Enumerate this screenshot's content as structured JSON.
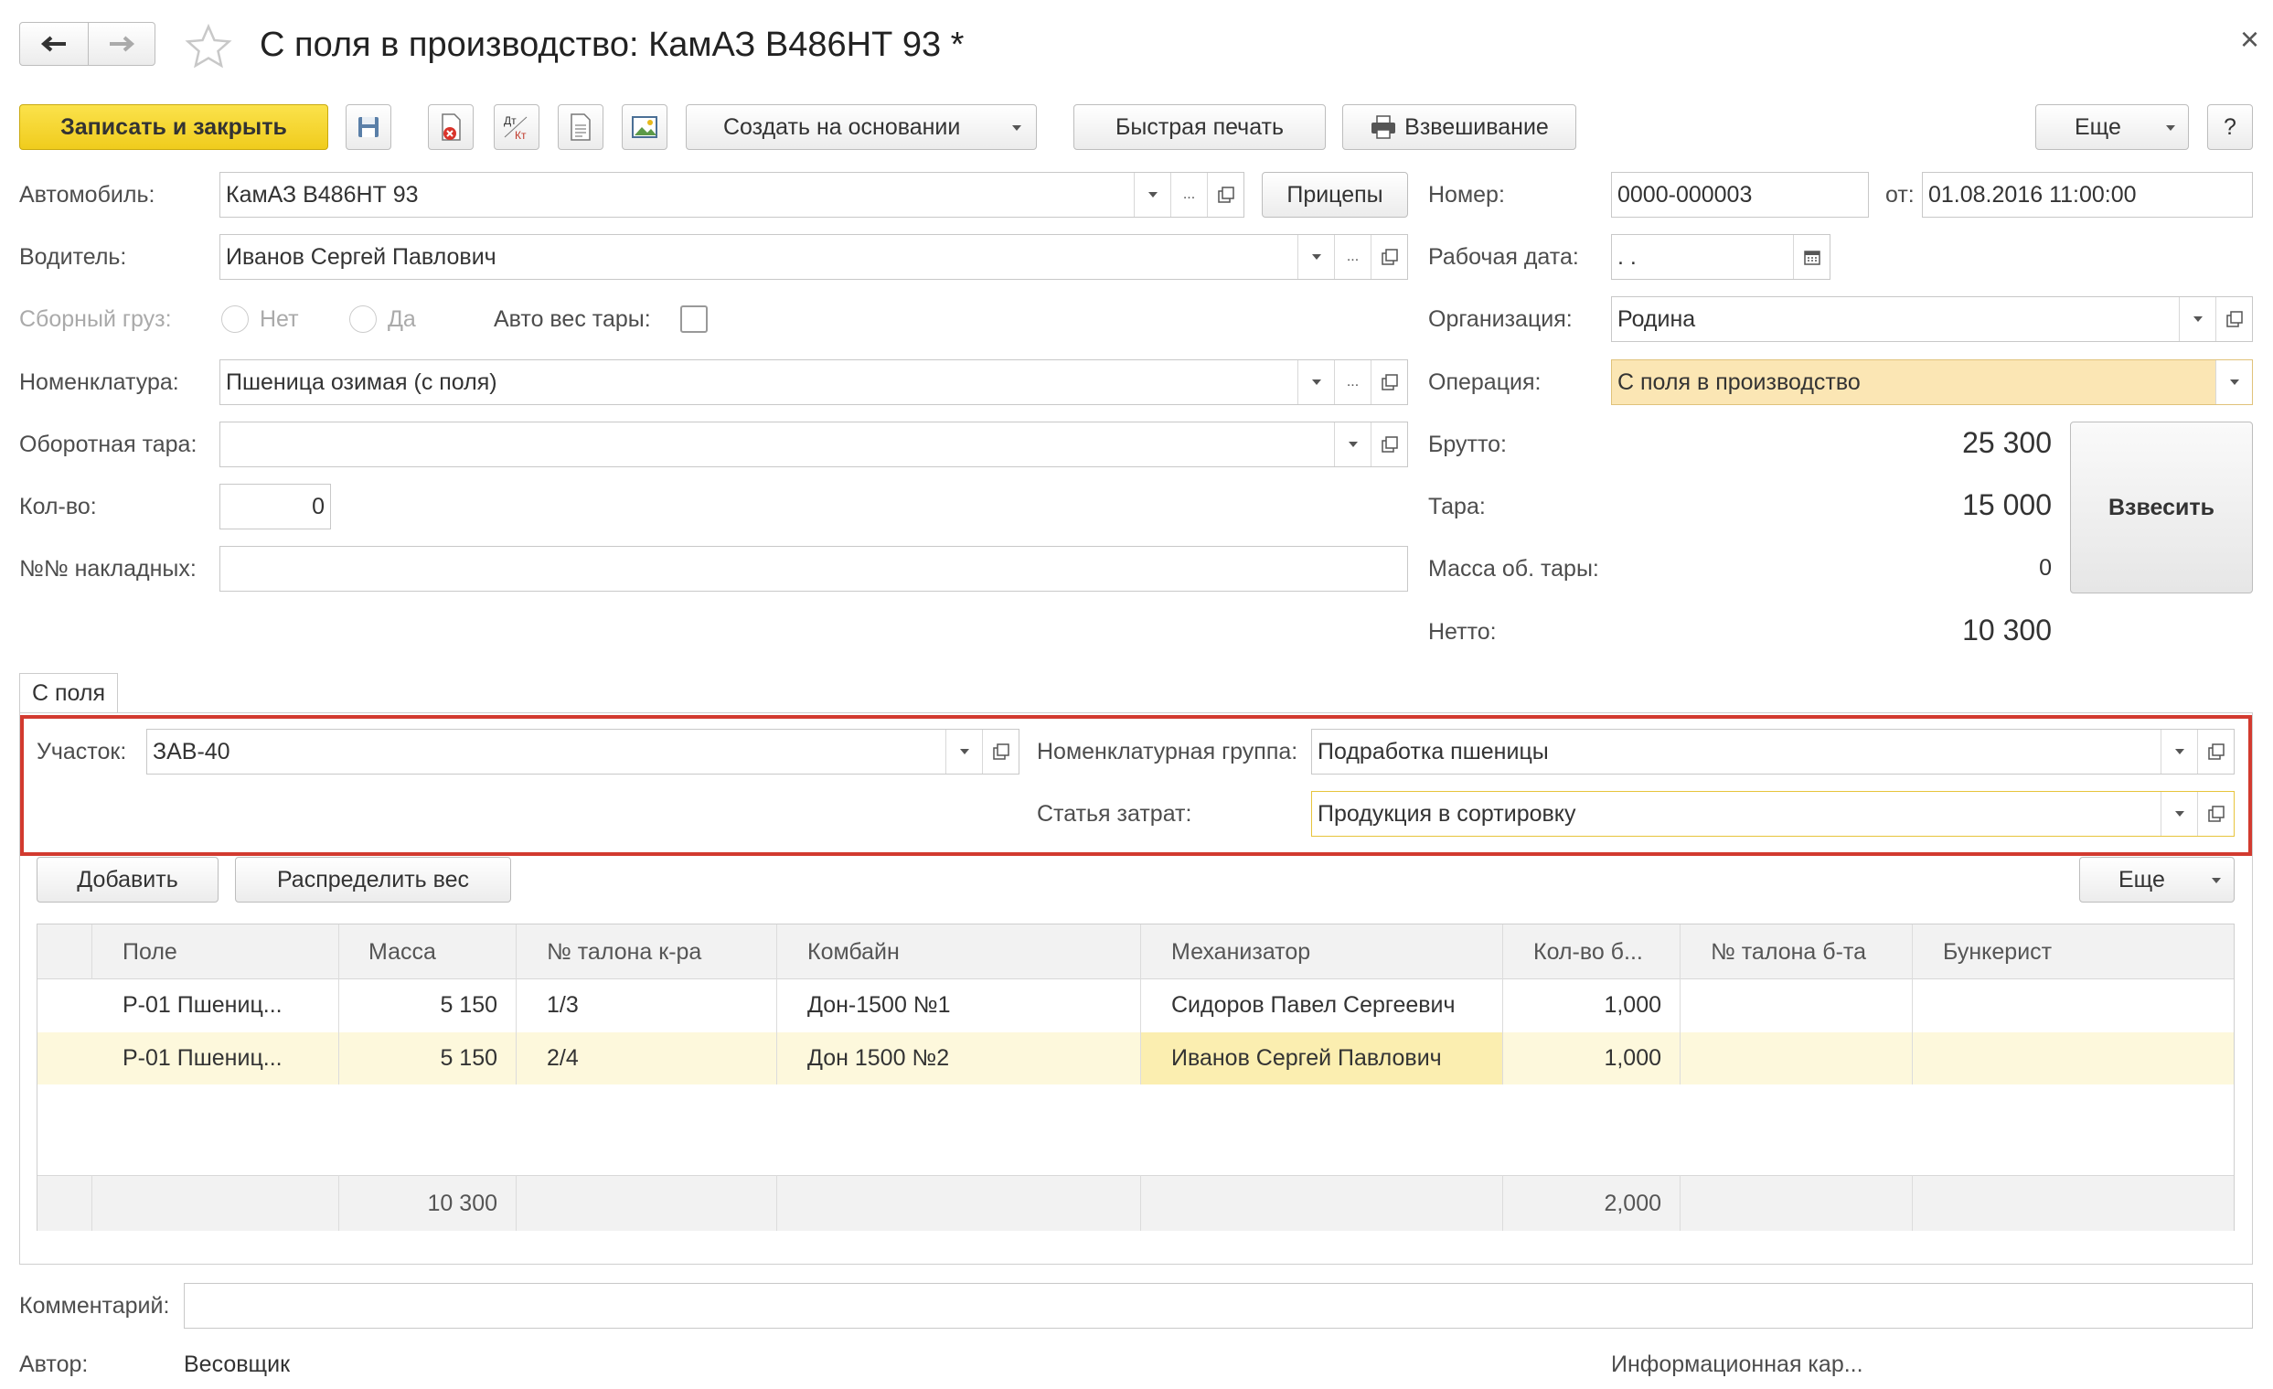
{
  "window": {
    "title": "С поля в производство: КамАЗ В486НТ 93 *",
    "close": "×"
  },
  "toolbar": {
    "save_close": "Записать и закрыть",
    "dtkt": "Дт\nКт",
    "create_based": "Создать на основании",
    "quick_print": "Быстрая печать",
    "weighing": "Взвешивание",
    "more": "Еще",
    "help": "?"
  },
  "left": {
    "car_label": "Автомобиль:",
    "car_value": "КамАЗ В486НТ 93",
    "trailers": "Прицепы",
    "driver_label": "Водитель:",
    "driver_value": "Иванов Сергей Павлович",
    "combined_label": "Сборный груз:",
    "radio_no": "Нет",
    "radio_yes": "Да",
    "auto_tare_label": "Авто вес тары:",
    "nomenclature_label": "Номенклатура:",
    "nomenclature_value": "Пшеница озимая (с поля)",
    "tare_label": "Оборотная тара:",
    "tare_value": "",
    "qty_label": "Кол-во:",
    "qty_value": "0",
    "invoices_label": "№№ накладных:",
    "invoices_value": ""
  },
  "right": {
    "number_label": "Номер:",
    "number_value": "0000-000003",
    "from_label": "от:",
    "from_value": "01.08.2016 11:00:00",
    "workdate_label": "Рабочая дата:",
    "workdate_value": " .  .",
    "org_label": "Организация:",
    "org_value": "Родина",
    "operation_label": "Операция:",
    "operation_value": "С поля в производство",
    "gross_label": "Брутто:",
    "gross_value": "25 300",
    "tare_label": "Тара:",
    "tare_value": "15 000",
    "tare_mass_label": "Масса об. тары:",
    "tare_mass_value": "0",
    "net_label": "Нетто:",
    "net_value": "10 300",
    "weigh_button": "Взвесить"
  },
  "tab": {
    "label": "С поля"
  },
  "group": {
    "section_label": "Участок:",
    "section_value": "ЗАВ-40",
    "nom_group_label": "Номенклатурная группа:",
    "nom_group_value": "Подработка пшеницы",
    "cost_label": "Статья затрат:",
    "cost_value": "Продукция в сортировку"
  },
  "table_toolbar": {
    "add": "Добавить",
    "distribute": "Распределить вес",
    "more": "Еще"
  },
  "table": {
    "headers": [
      "Поле",
      "Масса",
      "№ талона к-ра",
      "Комбайн",
      "Механизатор",
      "Кол-во б...",
      "№ талона б-та",
      "Бункерист"
    ],
    "rows": [
      [
        "Р-01 Пшениц...",
        "5 150",
        "1/3",
        "Дон-1500 №1",
        "Сидоров Павел Сергеевич",
        "1,000",
        "",
        ""
      ],
      [
        "Р-01 Пшениц...",
        "5 150",
        "2/4",
        "Дон 1500 №2",
        "Иванов Сергей Павлович",
        "1,000",
        "",
        ""
      ]
    ],
    "totals": {
      "mass": "10 300",
      "count": "2,000"
    }
  },
  "footer": {
    "comment_label": "Комментарий:",
    "comment_value": "",
    "author_label": "Автор:",
    "author_value": "Весовщик",
    "info_card": "Информационная кар..."
  },
  "colors": {
    "primary": "#f5d632",
    "highlight_row": "#fdf8dc",
    "selected_cell": "#fbeeb0",
    "frame": "#d23a2f"
  }
}
